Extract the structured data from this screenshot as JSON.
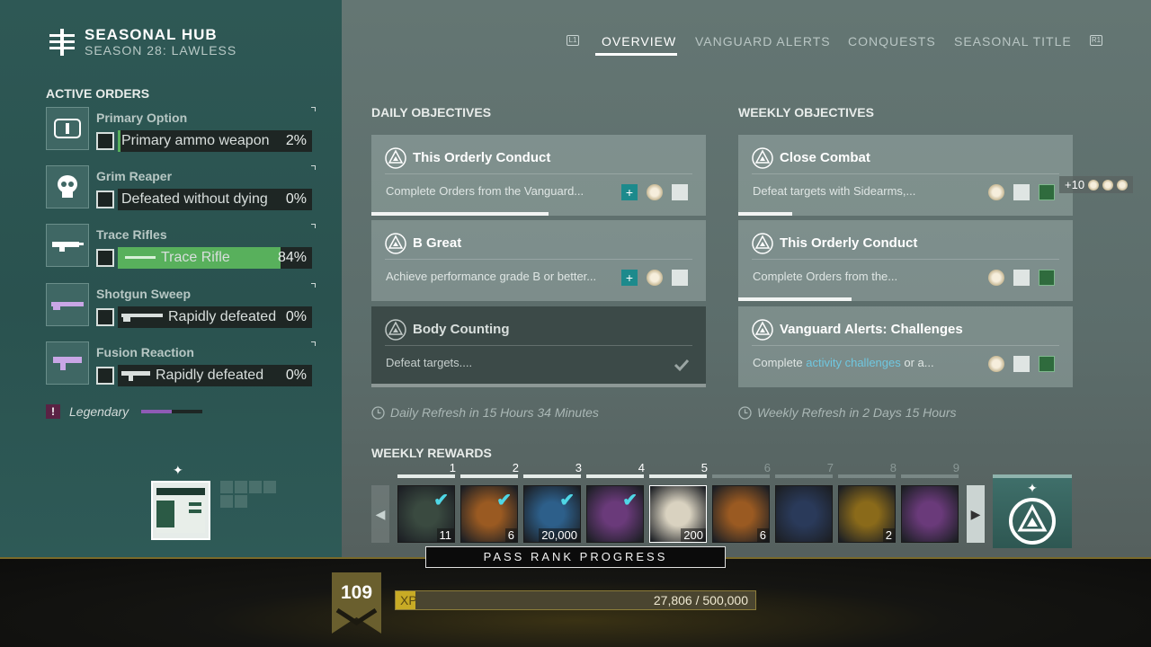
{
  "hub": {
    "title": "SEASONAL HUB",
    "subtitle": "SEASON 28: LAWLESS"
  },
  "nav": {
    "left_button": "L1",
    "right_button": "R1",
    "tabs": [
      {
        "label": "OVERVIEW",
        "active": true
      },
      {
        "label": "VANGUARD ALERTS",
        "active": false
      },
      {
        "label": "CONQUESTS",
        "active": false
      },
      {
        "label": "SEASONAL TITLE",
        "active": false
      }
    ]
  },
  "active_orders": {
    "heading": "ACTIVE ORDERS",
    "items": [
      {
        "name": "Primary Option",
        "objective": "Primary ammo weapon",
        "percent": "2%",
        "progress": 0.02,
        "icon": "primary-ammo-icon"
      },
      {
        "name": "Grim Reaper",
        "objective": "Defeated without dying",
        "percent": "0%",
        "progress": 0.0,
        "icon": "skull-icon"
      },
      {
        "name": "Trace Rifles",
        "objective": "Trace Rifle",
        "percent": "84%",
        "progress": 0.84,
        "icon": "trace-rifle-icon"
      },
      {
        "name": "Shotgun Sweep",
        "objective": "Rapidly defeated",
        "percent": "0%",
        "progress": 0.0,
        "icon": "shotgun-icon"
      },
      {
        "name": "Fusion Reaction",
        "objective": "Rapidly defeated",
        "percent": "0%",
        "progress": 0.0,
        "icon": "fusion-rifle-icon"
      }
    ],
    "legendary_label": "Legendary",
    "legendary_badge": "!",
    "legendary_progress": 0.5
  },
  "daily": {
    "heading": "DAILY OBJECTIVES",
    "refresh": "Daily Refresh in 15 Hours 34 Minutes",
    "cards": [
      {
        "title": "This Orderly Conduct",
        "desc": "Complete Orders from the Vanguard...",
        "progress": 0.53
      },
      {
        "title": "B Great",
        "desc": "Achieve performance grade B or better...",
        "progress": 0.0
      },
      {
        "title": "Body Counting",
        "desc": "Defeat targets....",
        "progress": 1.0,
        "completed": true
      }
    ]
  },
  "weekly": {
    "heading": "WEEKLY OBJECTIVES",
    "refresh": "Weekly Refresh in 2 Days 15 Hours",
    "cards": [
      {
        "title": "Close Combat",
        "desc": "Defeat targets with Sidearms,...",
        "progress": 0.16
      },
      {
        "title": "This Orderly Conduct",
        "desc": "Complete Orders from the...",
        "progress": 0.34
      },
      {
        "title": "Vanguard Alerts: Challenges",
        "desc_pre": "Complete ",
        "desc_hl": "activity challenges",
        "desc_post": " or a...",
        "progress": 0.0
      }
    ],
    "bonus": "+10"
  },
  "weekly_rewards": {
    "heading": "WEEKLY REWARDS",
    "items": [
      {
        "rank": "1",
        "count": "11",
        "claimed": true,
        "color": "#3a4a40"
      },
      {
        "rank": "2",
        "count": "6",
        "claimed": true,
        "color": "#9a5a22"
      },
      {
        "rank": "3",
        "count": "20,000",
        "claimed": true,
        "color": "#2d5f8a"
      },
      {
        "rank": "4",
        "count": "",
        "claimed": true,
        "color": "#6a3a7a"
      },
      {
        "rank": "5",
        "count": "200",
        "claimed": false,
        "color": "#d9d2c0"
      },
      {
        "rank": "6",
        "count": "6",
        "claimed": false,
        "color": "#9a5a22"
      },
      {
        "rank": "7",
        "count": "",
        "claimed": false,
        "color": "#2a3a5a"
      },
      {
        "rank": "8",
        "count": "2",
        "claimed": false,
        "color": "#8a6a1a"
      },
      {
        "rank": "9",
        "count": "",
        "claimed": false,
        "color": "#6a3a7a"
      }
    ]
  },
  "pass": {
    "label": "PASS RANK PROGRESS",
    "rank": "109",
    "xp_label": "XP",
    "xp_value": "27,806 / 500,000",
    "xp_progress": 0.0556
  }
}
